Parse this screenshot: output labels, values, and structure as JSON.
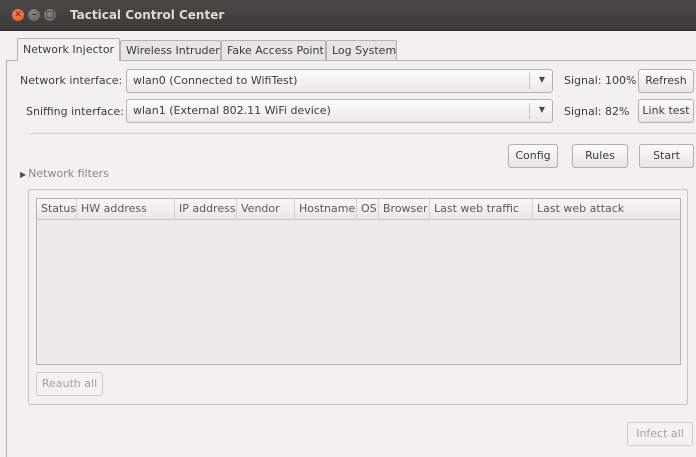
{
  "window": {
    "title": "Tactical Control Center",
    "close_glyph": "✕",
    "minimize_glyph": "–",
    "maximize_glyph": "□"
  },
  "tabs": [
    {
      "label": "Network Injector",
      "active": true
    },
    {
      "label": "Wireless Intruder",
      "active": false
    },
    {
      "label": "Fake Access Point",
      "active": false
    },
    {
      "label": "Log System",
      "active": false
    }
  ],
  "network_interface": {
    "label": "Network interface:",
    "selected": "wlan0 (Connected to WifiTest)",
    "signal": "Signal: 100%",
    "button": "Refresh"
  },
  "sniffing_interface": {
    "label": "Sniffing interface:",
    "selected": "wlan1 (External 802.11 WiFi device)",
    "signal": "Signal:  82%",
    "button": "Link test"
  },
  "actions": {
    "config": "Config",
    "rules": "Rules",
    "start": "Start"
  },
  "filters": {
    "label": "Network filters",
    "expanded": false
  },
  "table": {
    "columns": [
      "Status",
      "HW address",
      "IP address",
      "Vendor",
      "Hostname",
      "OS",
      "Browser",
      "Last web traffic",
      "Last web attack"
    ],
    "rows": []
  },
  "reauth_button": "Reauth all",
  "infect_button": "Infect all",
  "colors": {
    "titlebar": "#3c3b37",
    "close_button": "#e8531f",
    "window_bg": "#f2f1f0"
  },
  "icons": {
    "close": "close-icon",
    "minimize": "minimize-icon",
    "maximize": "maximize-icon",
    "dropdown": "chevron-down-icon",
    "expander": "triangle-right-icon"
  }
}
